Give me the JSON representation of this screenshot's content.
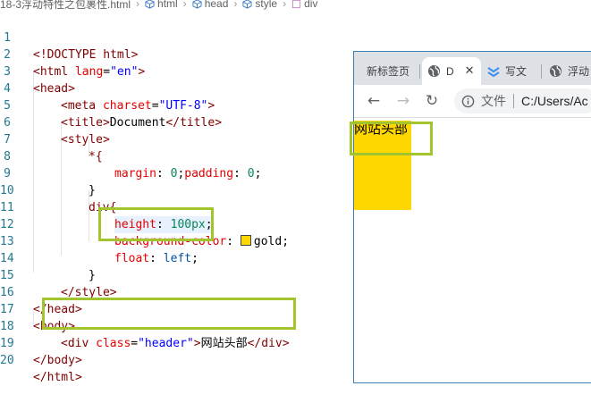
{
  "breadcrumb": {
    "file": "18-3浮动特性之包裹性.html",
    "items": [
      "html",
      "head",
      "style",
      "div"
    ]
  },
  "editor": {
    "lines": [
      {
        "n": "1"
      },
      {
        "n": "2"
      },
      {
        "n": "3"
      },
      {
        "n": "4"
      },
      {
        "n": "5"
      },
      {
        "n": "6"
      },
      {
        "n": "7"
      },
      {
        "n": "8"
      },
      {
        "n": "9"
      },
      {
        "n": "10"
      },
      {
        "n": "11"
      },
      {
        "n": "12"
      },
      {
        "n": "13"
      },
      {
        "n": "14"
      },
      {
        "n": "15"
      },
      {
        "n": "16"
      },
      {
        "n": "17"
      },
      {
        "n": "18"
      },
      {
        "n": "19"
      },
      {
        "n": "20"
      }
    ],
    "code": {
      "l1": [
        "<!DOCTYPE ",
        "html",
        ">"
      ],
      "l2": [
        "<html ",
        "lang",
        "=",
        "\"en\"",
        ">"
      ],
      "l3": [
        "<head>"
      ],
      "l4": [
        "<meta ",
        "charset",
        "=",
        "\"UTF-8\"",
        ">"
      ],
      "l5": [
        "<title>",
        "Document",
        "</title>"
      ],
      "l6": [
        "<style>"
      ],
      "l7": [
        "*{"
      ],
      "l8": [
        "margin",
        ": ",
        "0",
        ";",
        "padding",
        ": ",
        "0",
        ";"
      ],
      "l9": [
        "}"
      ],
      "l10": [
        "div{"
      ],
      "l11": [
        "height",
        ": ",
        "100px",
        ";"
      ],
      "l12": [
        "background-color",
        ": ",
        "gold",
        ";"
      ],
      "l13": [
        "float",
        ": ",
        "left",
        ";"
      ],
      "l14": [
        "}"
      ],
      "l15": [
        "</style>"
      ],
      "l16": [
        "</head>"
      ],
      "l17": [
        "<body>"
      ],
      "l18": [
        "<div ",
        "class",
        "=",
        "\"header\"",
        ">",
        "网站头部",
        "</div>"
      ],
      "l19": [
        "</body>"
      ],
      "l20": [
        "</html>"
      ]
    }
  },
  "browser": {
    "tabs": {
      "newtab": "新标签页",
      "active": "D",
      "tab3": "写文",
      "tab4": "浮动"
    },
    "address": {
      "scheme_label": "文件",
      "path": "C:/Users/Ac"
    },
    "page": {
      "header_text": "网站头部",
      "header_bg": "#ffd700"
    }
  },
  "colors": {
    "highlight_box": "#a2c42d",
    "gold": "#ffd700"
  }
}
